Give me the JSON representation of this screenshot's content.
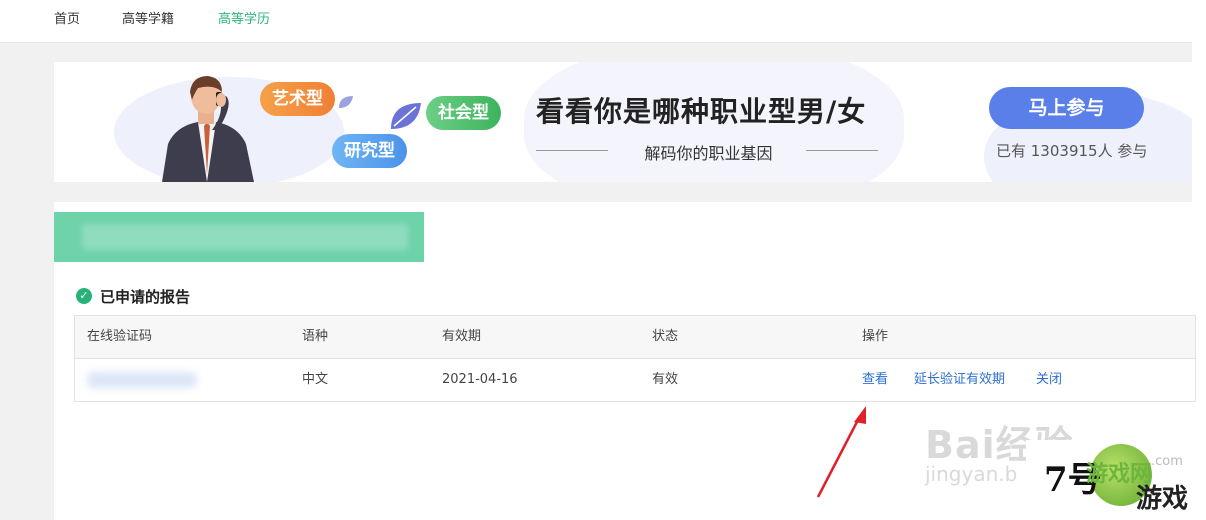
{
  "nav": {
    "items": [
      {
        "label": "首页"
      },
      {
        "label": "高等学籍"
      },
      {
        "label": "高等学历"
      }
    ],
    "active_index": 2
  },
  "banner": {
    "tags": [
      "艺术型",
      "社会型",
      "研究型"
    ],
    "title": "看看你是哪种职业型男/女",
    "subtitle": "解码你的职业基因",
    "button": "马上参与",
    "count_text": "已有 1303915人 参与"
  },
  "section": {
    "title": "已申请的报告"
  },
  "table": {
    "headers": [
      "在线验证码",
      "语种",
      "有效期",
      "状态",
      "操作"
    ],
    "rows": [
      {
        "code": "",
        "language": "中文",
        "expiry": "2021-04-16",
        "status": "有效",
        "actions": [
          "查看",
          "延长验证有效期",
          "关闭"
        ]
      }
    ]
  },
  "watermarks": {
    "baidu": "Bai经验",
    "baidu_sub": "jingyan.b",
    "logo_num": "7号",
    "logo_game": "游戏网",
    "logo_bottom": "游戏",
    "logo_domain": ".com"
  },
  "colors": {
    "accent_green": "#2db37e",
    "link_blue": "#2d6fcf",
    "button_blue": "#5b7fe8",
    "arrow_red": "#e0202a"
  }
}
